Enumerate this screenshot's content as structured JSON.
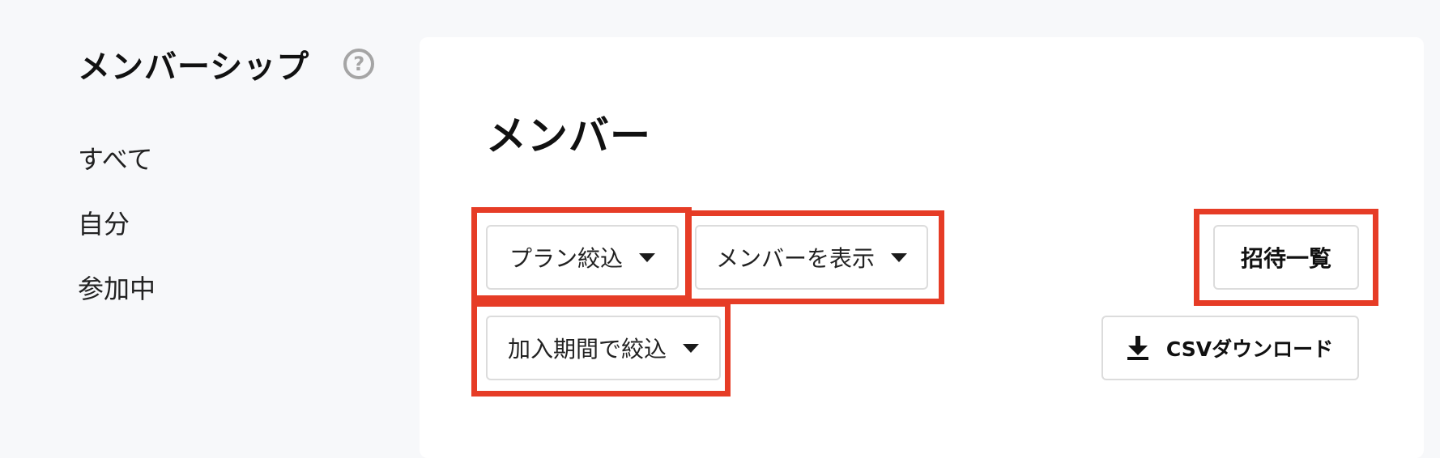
{
  "sidebar": {
    "title": "メンバーシップ",
    "help_icon": "?",
    "items": [
      {
        "label": "すべて"
      },
      {
        "label": "自分"
      },
      {
        "label": "参加中"
      }
    ]
  },
  "main": {
    "title": "メンバー",
    "filters": {
      "plan_filter": "プラン絞込",
      "member_display": "メンバーを表示",
      "period_filter": "加入期間で絞込"
    },
    "actions": {
      "invite_list": "招待一覧",
      "csv_download": "CSVダウンロード"
    }
  },
  "colors": {
    "highlight": "#e63c26",
    "background": "#f7f8fa",
    "panel": "#ffffff"
  },
  "icons": [
    "help-icon",
    "chevron-down-icon",
    "download-icon"
  ]
}
